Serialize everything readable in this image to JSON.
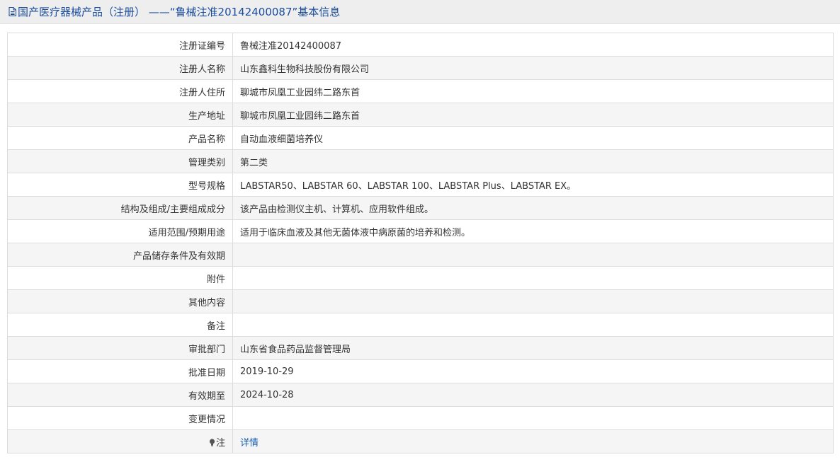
{
  "header": {
    "title": "国产医疗器械产品（注册） ——“鲁械注准20142400087”基本信息",
    "icon": "document-icon"
  },
  "rows": [
    {
      "label": "注册证编号",
      "value": "鲁械注准20142400087"
    },
    {
      "label": "注册人名称",
      "value": "山东鑫科生物科技股份有限公司"
    },
    {
      "label": "注册人住所",
      "value": "聊城市凤凰工业园纬二路东首"
    },
    {
      "label": "生产地址",
      "value": "聊城市凤凰工业园纬二路东首"
    },
    {
      "label": "产品名称",
      "value": "自动血液细菌培养仪"
    },
    {
      "label": "管理类别",
      "value": "第二类"
    },
    {
      "label": "型号规格",
      "value": "LABSTAR50、LABSTAR 60、LABSTAR 100、LABSTAR Plus、LABSTAR EX。"
    },
    {
      "label": "结构及组成/主要组成成分",
      "value": "该产品由检测仪主机、计算机、应用软件组成。"
    },
    {
      "label": "适用范围/预期用途",
      "value": "适用于临床血液及其他无菌体液中病原菌的培养和检测。"
    },
    {
      "label": "产品储存条件及有效期",
      "value": ""
    },
    {
      "label": "附件",
      "value": ""
    },
    {
      "label": "其他内容",
      "value": ""
    },
    {
      "label": "备注",
      "value": ""
    },
    {
      "label": "审批部门",
      "value": "山东省食品药品监督管理局"
    },
    {
      "label": "批准日期",
      "value": "2019-10-29"
    },
    {
      "label": "有效期至",
      "value": "2024-10-28"
    },
    {
      "label": "变更情况",
      "value": ""
    }
  ],
  "note_row": {
    "label": "注",
    "icon": "lightbulb-icon",
    "link_text": "详情"
  },
  "colors": {
    "header_text": "#1a4c9c",
    "link": "#1a5fb4",
    "stripe": "#f5f5f5",
    "border": "#dcdcdc"
  }
}
